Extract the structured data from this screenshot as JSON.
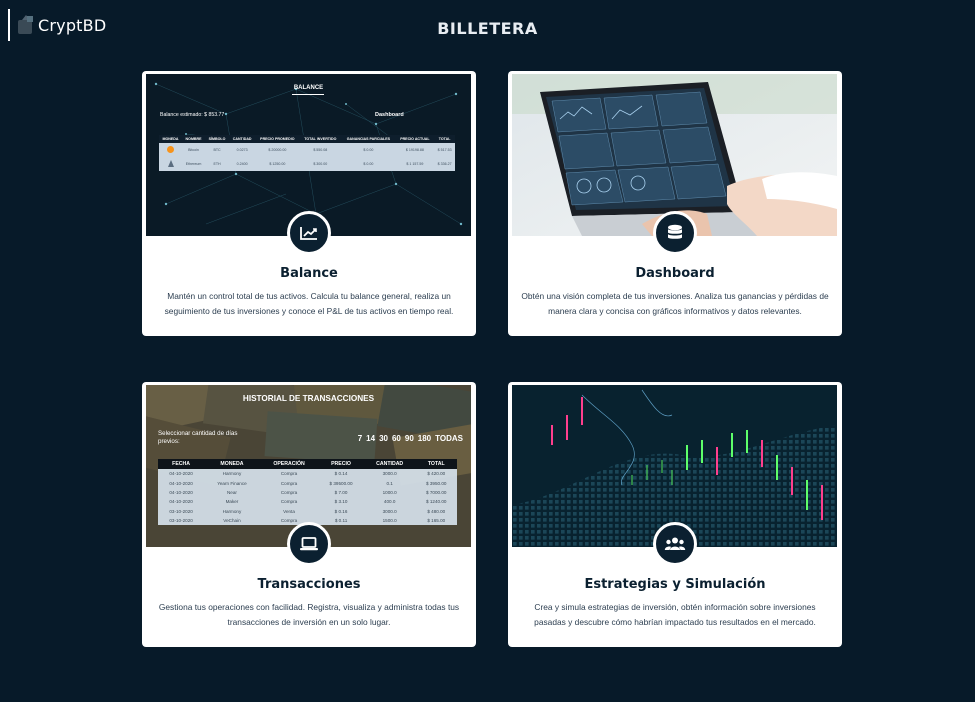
{
  "app": {
    "logo_text": "CryptBD",
    "page_title": "BILLETERA"
  },
  "colors": {
    "background": "#071a29",
    "card_bg": "#ffffff",
    "badge_bg": "#0b2030",
    "title_color": "#0b2030"
  },
  "cards": [
    {
      "title": "Balance",
      "icon": "chart-line-icon",
      "description": "Mantén un control total de tus activos. Calcula tu balance general, realiza un seguimiento de tus inversiones y conoce el P&L de tus activos en tiempo real.",
      "preview": {
        "heading": "BALANCE",
        "estimate_label": "Balance estimado: $ 853.77",
        "link": "Dashboard",
        "columns": [
          "MONEDA",
          "NOMBRE",
          "SÍMBOLO",
          "CANTIDAD",
          "PRECIO PROMEDIO",
          "TOTAL INVERTIDO",
          "GANANCIAS PARCIALES",
          "PRECIO ACTUAL",
          "TOTAL"
        ],
        "rows": [
          [
            "",
            "Bitcoin",
            "BTC",
            "0.0273",
            "$ 20000.00",
            "$ 550.08",
            "$ 0.00",
            "$ 19198.88",
            "$ 517.53"
          ],
          [
            "",
            "Ethereum",
            "ETH",
            "0.2400",
            "$ 1250.00",
            "$ 300.00",
            "$ 0.00",
            "$ 1 157.59",
            "$ 336.27"
          ]
        ]
      }
    },
    {
      "title": "Dashboard",
      "icon": "database-icon",
      "description": "Obtén una visión completa de tus inversiones. Analiza tus ganancias y pérdidas de manera clara y concisa con gráficos informativos y datos relevantes."
    },
    {
      "title": "Transacciones",
      "icon": "laptop-icon",
      "description": "Gestiona tus operaciones con facilidad. Registra, visualiza y administra todas tus transacciones de inversión en un solo lugar.",
      "preview": {
        "heading": "HISTORIAL DE TRANSACCIONES",
        "select_label": "Seleccionar cantidad de días previos:",
        "day_options": [
          "7",
          "14",
          "30",
          "60",
          "90",
          "180",
          "TODAS"
        ],
        "columns": [
          "FECHA",
          "MONEDA",
          "OPERACIÓN",
          "PRECIO",
          "CANTIDAD",
          "TOTAL"
        ],
        "rows": [
          [
            "04-10-2020",
            "Harmony",
            "Compra",
            "$ 0.14",
            "3000.0",
            "$ 420.00"
          ],
          [
            "04-10-2020",
            "Yearn Finance",
            "Compra",
            "$ 39500.00",
            "0.1",
            "$ 3950.00"
          ],
          [
            "04-10-2020",
            "Near",
            "Compra",
            "$ 7.00",
            "1000.0",
            "$ 7000.00"
          ],
          [
            "04-10-2020",
            "Maker",
            "Compra",
            "$ 3.10",
            "400.0",
            "$ 1240.00"
          ],
          [
            "03-10-2020",
            "Harmony",
            "Venta",
            "$ 0.16",
            "3000.0",
            "$ 480.00"
          ],
          [
            "03-10-2020",
            "VeChain",
            "Compra",
            "$ 0.11",
            "1500.0",
            "$ 165.00"
          ]
        ]
      }
    },
    {
      "title": "Estrategias y Simulación",
      "icon": "users-icon",
      "description": "Crea y simula estrategias de inversión, obtén información sobre inversiones pasadas y descubre cómo habrían impactado tus resultados en el mercado."
    }
  ]
}
